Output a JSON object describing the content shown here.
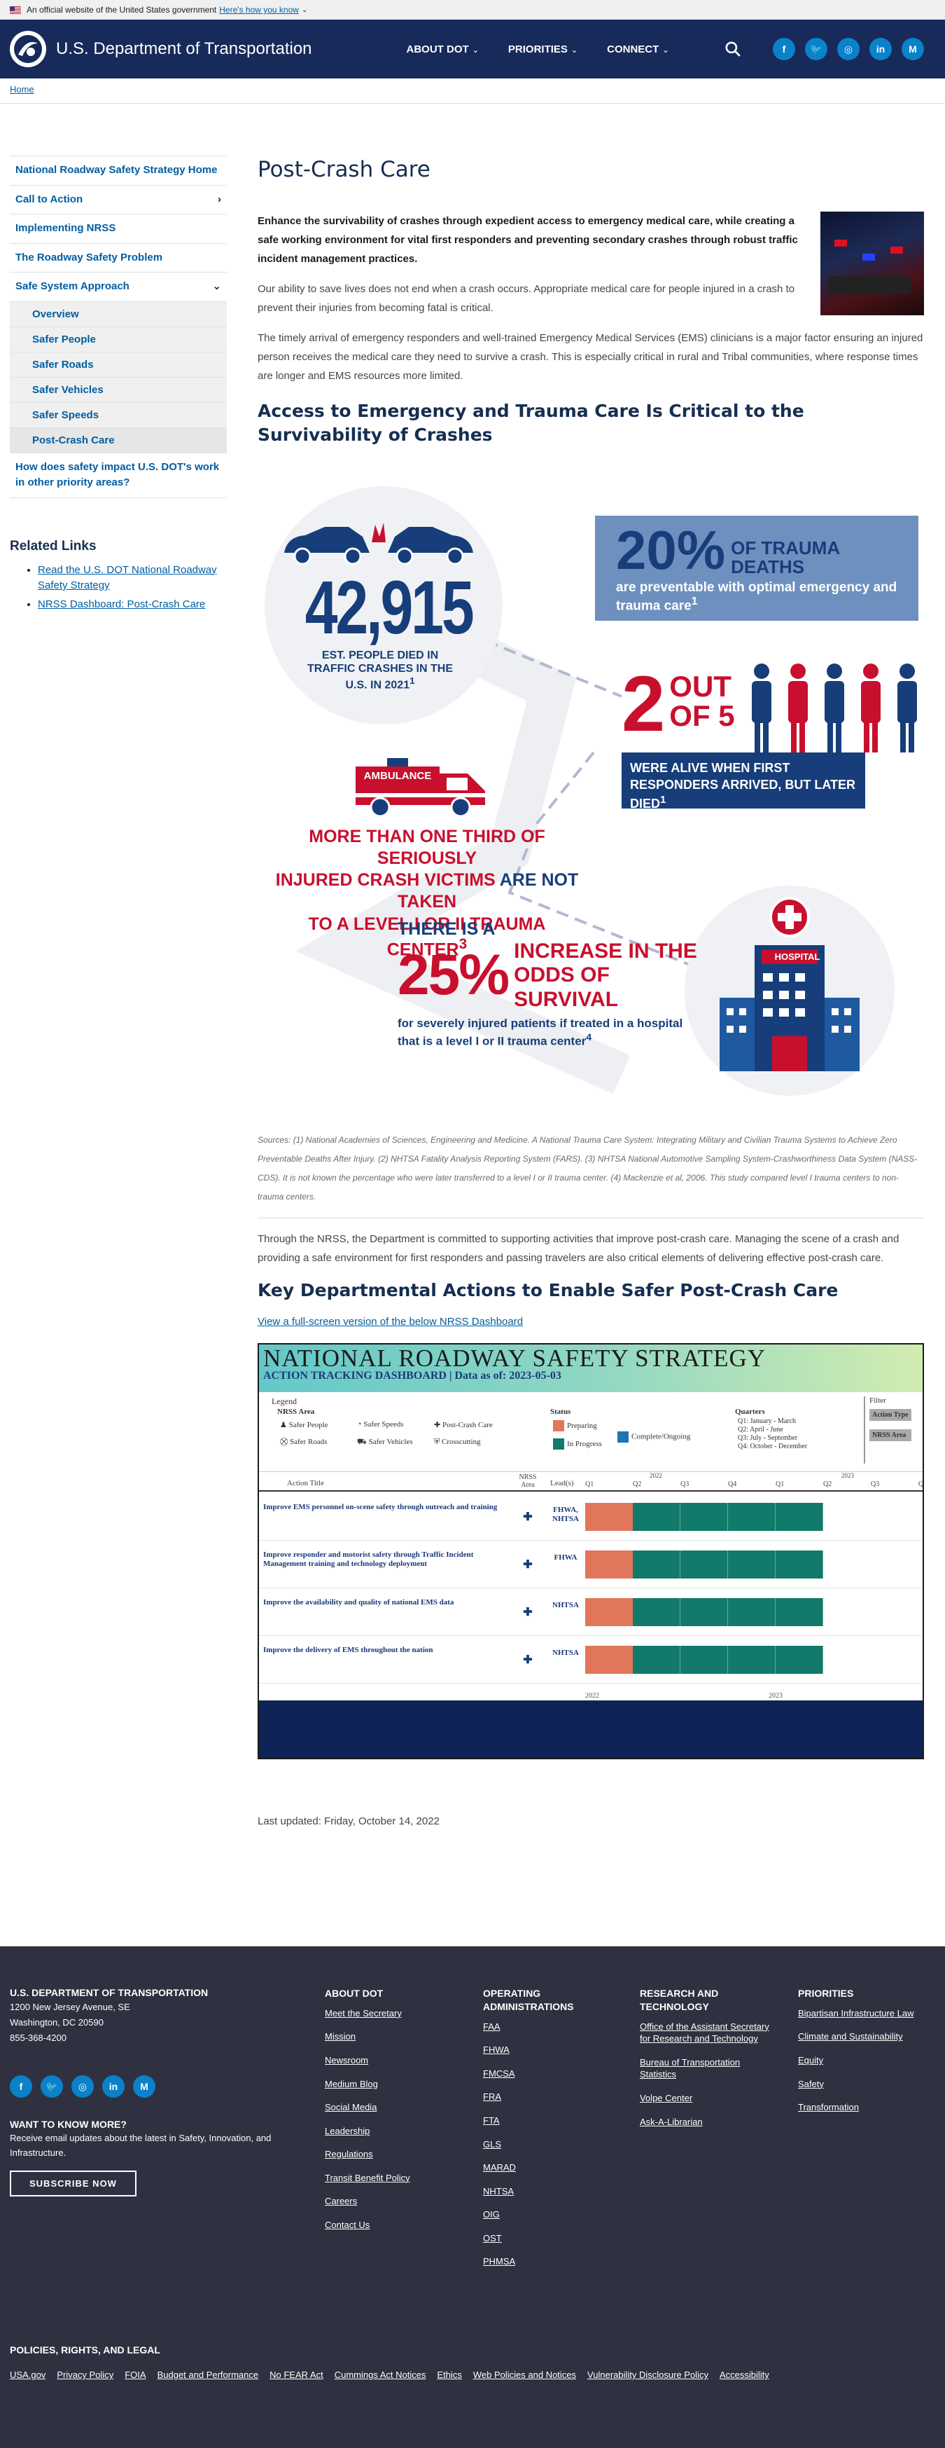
{
  "banner": {
    "text": "An official website of the United States government",
    "link": "Here's how you know"
  },
  "header": {
    "title": "U.S. Department of Transportation",
    "nav": [
      "ABOUT DOT",
      "PRIORITIES",
      "CONNECT"
    ],
    "social": [
      "f",
      "t",
      "ig",
      "in",
      "M"
    ]
  },
  "breadcrumb": "Home",
  "sidenav": {
    "items": [
      {
        "label": "National Roadway Safety Strategy Home",
        "arrow": ""
      },
      {
        "label": "Call to Action",
        "arrow": "›"
      },
      {
        "label": "Implementing NRSS",
        "arrow": ""
      },
      {
        "label": "The Roadway Safety Problem",
        "arrow": ""
      },
      {
        "label": "Safe System Approach",
        "arrow": "⌄"
      }
    ],
    "subitems": [
      "Overview",
      "Safer People",
      "Safer Roads",
      "Safer Vehicles",
      "Safer Speeds",
      "Post-Crash Care"
    ],
    "last": "How does safety impact U.S. DOT's work in other priority areas?"
  },
  "related": {
    "title": "Related Links",
    "links": [
      "Read the U.S. DOT National Roadway Safety Strategy",
      "NRSS Dashboard: Post-Crash Care"
    ]
  },
  "main": {
    "title": "Post-Crash Care",
    "lead": "Enhance the survivability of crashes through expedient access to emergency medical care, while creating a safe working environment for vital first responders and preventing secondary crashes through robust traffic incident management practices.",
    "p1": "Our ability to save lives does not end when a crash occurs. Appropriate medical care for people injured in a crash to prevent their injuries from becoming fatal is critical.",
    "p2": "The timely arrival of emergency responders and well-trained Emergency Medical Services (EMS) clinicians is a major factor ensuring an injured person receives the medical care they need to survive a crash. This is especially critical in rural and Tribal communities, where response times are longer and EMS resources more limited.",
    "h2": "Access to Emergency and Trauma Care Is Critical to the Survivability of Crashes",
    "infographic": {
      "stat1": "42,915",
      "stat1_label": "EST. PEOPLE DIED IN TRAFFIC CRASHES IN THE U.S. IN 2021",
      "stat1_sup": "1",
      "stat2_pct": "20%",
      "stat2_head": "OF TRAUMA DEATHS",
      "stat2_body": "are preventable with optimal emergency and trauma care",
      "stat2_sup": "1",
      "stat3_num": "2",
      "stat3_out": "OUT",
      "stat3_of": "OF 5",
      "stat3_body": "WERE ALIVE WHEN FIRST RESPONDERS ARRIVED, BUT LATER DIED",
      "stat3_sup": "1",
      "ambulance": "AMBULANCE",
      "stat4_a": "MORE THAN ONE THIRD OF SERIOUSLY",
      "stat4_b": "INJURED CRASH VICTIMS ",
      "stat4_c": "ARE NOT",
      "stat4_d": " TAKEN",
      "stat4_e": "TO A LEVEL I OR II TRAUMA CENTER",
      "stat4_sup": "3",
      "stat5_pre": "THERE IS A",
      "stat5_pct": "25%",
      "stat5_big": "INCREASE IN THE ODDS OF SURVIVAL",
      "stat5_body": "for severely injured patients if treated in a hospital that is a level I or II trauma center",
      "stat5_sup": "4",
      "hospital": "HOSPITAL"
    },
    "sources": "Sources: (1) National Academies of Sciences, Engineering and Medicine. A National Trauma Care System: Integrating Military and Civilian Trauma Systems to Achieve Zero Preventable Deaths After Injury. (2) NHTSA Fatality Analysis Reporting System (FARS). (3) NHTSA National Automotive Sampling System-Crashworthiness Data System (NASS-CDS). It is not known the percentage who were later transferred to a level I or II trauma center. (4) Mackenzie et al, 2006. This study compared level I trauma centers to non-trauma centers.",
    "p3": "Through the NRSS, the Department is committed to supporting activities that improve post-crash care. Managing the scene of a crash and providing a safe environment for first responders and passing travelers are also critical elements of delivering effective post-crash care.",
    "h2b": "Key Departmental Actions to Enable Safer Post-Crash Care",
    "dash_link": "View a full-screen version of the below NRSS Dashboard",
    "updated": "Last updated: Friday, October 14, 2022"
  },
  "dashboard": {
    "title": "NATIONAL ROADWAY SAFETY STRATEGY",
    "subtitle": "ACTION TRACKING DASHBOARD | Data as of: 2023-05-03",
    "legend_label": "Legend",
    "area_label": "NRSS Area",
    "areas": [
      "Safer People",
      "Safer Speeds",
      "Post-Crash Care",
      "Safer Roads",
      "Safer Vehicles",
      "Crosscutting"
    ],
    "status_label": "Status",
    "statuses": [
      "Preparing",
      "In Progress",
      "Complete/Ongoing"
    ],
    "quarters_label": "Quarters",
    "quarters": [
      "Q1: January - March",
      "Q2: April - June",
      "Q3: July - September",
      "Q4: October - December"
    ],
    "filter_label": "Filter",
    "filters": [
      "Action Type",
      "NRSS Area"
    ],
    "col_title": "Action Title",
    "col_area": "NRSS Area",
    "col_lead": "Lead(s)",
    "years": [
      "2022",
      "2023"
    ],
    "q_heads": [
      "Q1",
      "Q2",
      "Q3",
      "Q4",
      "Q1",
      "Q2",
      "Q3",
      "Q"
    ],
    "rows": [
      {
        "title": "Improve EMS personnel on-scene safety through outreach and training",
        "lead": "FHWA, NHTSA"
      },
      {
        "title": "Improve responder and motorist safety through Traffic Incident Management training and technology deployment",
        "lead": "FHWA"
      },
      {
        "title": "Improve the availability and quality of national EMS data",
        "lead": "NHTSA"
      },
      {
        "title": "Improve the delivery of EMS throughout the nation",
        "lead": "NHTSA"
      }
    ],
    "colors": {
      "preparing": "#e2765a",
      "progress": "#127a6a",
      "complete": "#1f74b5"
    }
  },
  "footer": {
    "org": "U.S. DEPARTMENT OF TRANSPORTATION",
    "addr1": "1200 New Jersey Avenue, SE",
    "addr2": "Washington, DC 20590",
    "phone": "855-368-4200",
    "want": "WANT TO KNOW MORE?",
    "want_body": "Receive email updates about the latest in Safety, Innovation, and Infrastructure.",
    "subscribe": "SUBSCRIBE NOW",
    "cols": [
      {
        "title": "ABOUT DOT",
        "links": [
          "Meet the Secretary",
          "Mission",
          "Newsroom",
          "Medium Blog",
          "Social Media",
          "Leadership",
          "Regulations",
          "Transit Benefit Policy",
          "Careers",
          "Contact Us"
        ]
      },
      {
        "title": "OPERATING ADMINISTRATIONS",
        "links": [
          "FAA",
          "FHWA",
          "FMCSA",
          "FRA",
          "FTA",
          "GLS",
          "MARAD",
          "NHTSA",
          "OIG",
          "OST",
          "PHMSA"
        ]
      },
      {
        "title": "RESEARCH AND TECHNOLOGY",
        "links": [
          "Office of the Assistant Secretary for Research and Technology",
          "Bureau of Transportation Statistics",
          "Volpe Center",
          "Ask-A-Librarian"
        ]
      },
      {
        "title": "PRIORITIES",
        "links": [
          "Bipartisan Infrastructure Law",
          "Climate and Sustainability",
          "Equity",
          "Safety",
          "Transformation"
        ]
      }
    ],
    "legal_title": "POLICIES, RIGHTS, AND LEGAL",
    "legal": [
      "USA.gov",
      "Privacy Policy",
      "FOIA",
      "Budget and Performance",
      "No FEAR Act",
      "Cummings Act Notices",
      "Ethics",
      "Web Policies and Notices",
      "Vulnerability Disclosure Policy",
      "Accessibility"
    ]
  }
}
